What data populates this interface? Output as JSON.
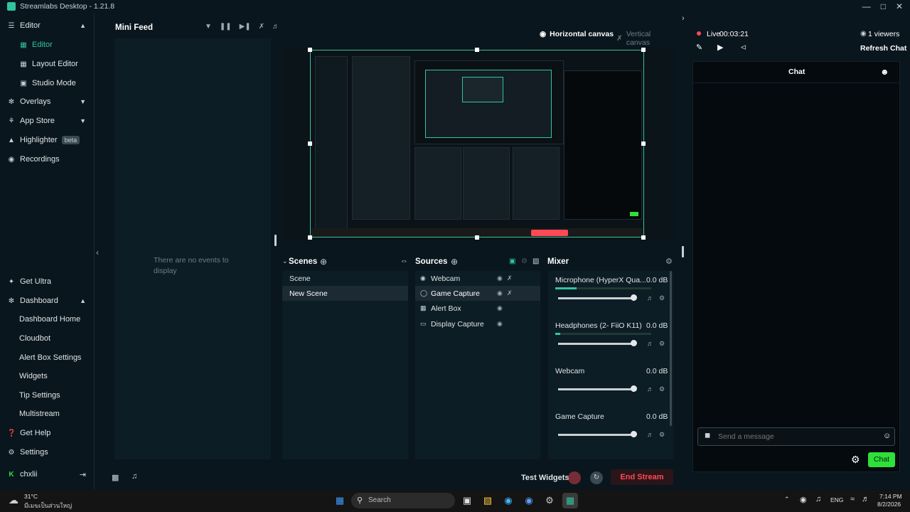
{
  "app": {
    "title": "Streamlabs Desktop - 1.21.8"
  },
  "sidebar": {
    "editor_group": "Editor",
    "items": [
      {
        "label": "Editor"
      },
      {
        "label": "Layout Editor"
      },
      {
        "label": "Studio Mode"
      }
    ],
    "overlays": "Overlays",
    "app_store": "App Store",
    "highlighter": "Highlighter",
    "highlighter_badge": "beta",
    "recordings": "Recordings",
    "get_ultra": "Get Ultra",
    "dashboard": "Dashboard",
    "dashboard_items": [
      {
        "label": "Dashboard Home"
      },
      {
        "label": "Cloudbot"
      },
      {
        "label": "Alert Box Settings"
      },
      {
        "label": "Widgets"
      },
      {
        "label": "Tip Settings"
      },
      {
        "label": "Multistream"
      }
    ],
    "get_help": "Get Help",
    "settings": "Settings",
    "user": "chxlii"
  },
  "minifeed": {
    "title": "Mini Feed",
    "empty_text": "There are no events to display"
  },
  "canvas": {
    "horizontal": "Horizontal canvas",
    "vertical": "Vertical canvas"
  },
  "scenes": {
    "title": "Scenes",
    "items": [
      {
        "label": "Scene"
      },
      {
        "label": "New Scene"
      }
    ]
  },
  "sources": {
    "title": "Sources",
    "items": [
      {
        "label": "Webcam",
        "icon": "webcam-icon"
      },
      {
        "label": "Game Capture",
        "icon": "gamepad-icon"
      },
      {
        "label": "Alert Box",
        "icon": "alert-icon"
      },
      {
        "label": "Display Capture",
        "icon": "monitor-icon"
      }
    ]
  },
  "mixer": {
    "title": "Mixer",
    "items": [
      {
        "name": "Microphone (HyperX Qua...",
        "db": "0.0 dB",
        "level": 0.22
      },
      {
        "name": "Headphones (2- FiiO K11)",
        "db": "0.0 dB",
        "level": 0.05
      },
      {
        "name": "Webcam",
        "db": "0.0 dB",
        "level": 0
      },
      {
        "name": "Game Capture",
        "db": "0.0 dB",
        "level": 0
      }
    ]
  },
  "footer": {
    "test_widgets": "Test Widgets",
    "end_stream": "End Stream"
  },
  "right": {
    "live_label": "Live",
    "timer": "00:03:21",
    "viewers": "1 viewers",
    "refresh_chat": "Refresh Chat",
    "chat_title": "Chat",
    "message_placeholder": "Send a message",
    "chat_button": "Chat"
  },
  "taskbar": {
    "weather_temp": "31°C",
    "weather_desc": "มีเมฆเป็นส่วนใหญ่",
    "search": "Search",
    "lang": "ENG",
    "time": "7:14 PM",
    "date": "8/2/2026"
  },
  "colors": {
    "accent": "#31c3a2",
    "end_stream": "#ff4a55",
    "chat_button": "#2ee03a",
    "live_dot": "#ff4a55"
  }
}
